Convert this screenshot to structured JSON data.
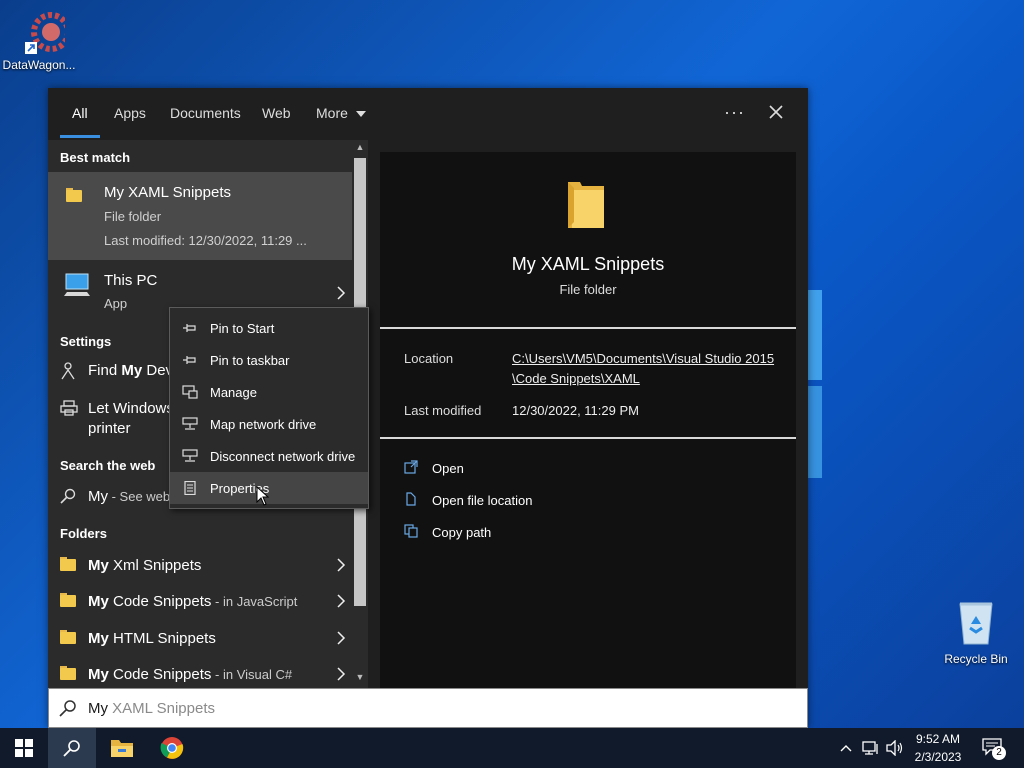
{
  "desktop": {
    "icons": [
      {
        "label": "DataWagon..."
      },
      {
        "label": "Recycle Bin"
      }
    ]
  },
  "search": {
    "tabs": [
      "All",
      "Apps",
      "Documents",
      "Web",
      "More"
    ],
    "active_tab": "All",
    "more_label": "More",
    "dots_label": "···",
    "query_typed": "My",
    "query_hint": " XAML Snippets",
    "left": {
      "best_match_header": "Best match",
      "best_match": {
        "title": "My XAML Snippets",
        "type": "File folder",
        "modified": "Last modified: 12/30/2022, 11:29 ..."
      },
      "this_pc": {
        "title": "This PC",
        "type": "App"
      },
      "settings_header": "Settings",
      "settings": [
        {
          "pre": "Find ",
          "bold": "My",
          "post": " Dev"
        },
        {
          "line1": "Let Windows",
          "line2": "printer"
        }
      ],
      "web_header": "Search the web",
      "web_item": {
        "bold": "My",
        "rest": " - See web"
      },
      "folders_header": "Folders",
      "folders": [
        {
          "bold": "My",
          "name": " Xml Snippets",
          "suffix": ""
        },
        {
          "bold": "My",
          "name": " Code Snippets",
          "suffix": " - in JavaScript"
        },
        {
          "bold": "My",
          "name": " HTML Snippets",
          "suffix": ""
        },
        {
          "bold": "My",
          "name": " Code Snippets",
          "suffix": " - in Visual C#"
        }
      ]
    },
    "preview": {
      "title": "My XAML Snippets",
      "type": "File folder",
      "location_label": "Location",
      "location_line1": "C:\\Users\\VM5\\Documents\\Visual Studio 2015",
      "location_line2": "\\Code Snippets\\XAML",
      "modified_label": "Last modified",
      "modified_value": "12/30/2022, 11:29 PM",
      "actions": [
        "Open",
        "Open file location",
        "Copy path"
      ]
    }
  },
  "context_menu": {
    "items": [
      "Pin to Start",
      "Pin to taskbar",
      "Manage",
      "Map network drive",
      "Disconnect network drive",
      "Properties"
    ],
    "hovered": "Properties"
  },
  "taskbar": {
    "time": "9:52 AM",
    "date": "2/3/2023",
    "notification_count": "2"
  },
  "colors": {
    "accent": "#3a8fe0",
    "folder": "#f2c94c"
  }
}
